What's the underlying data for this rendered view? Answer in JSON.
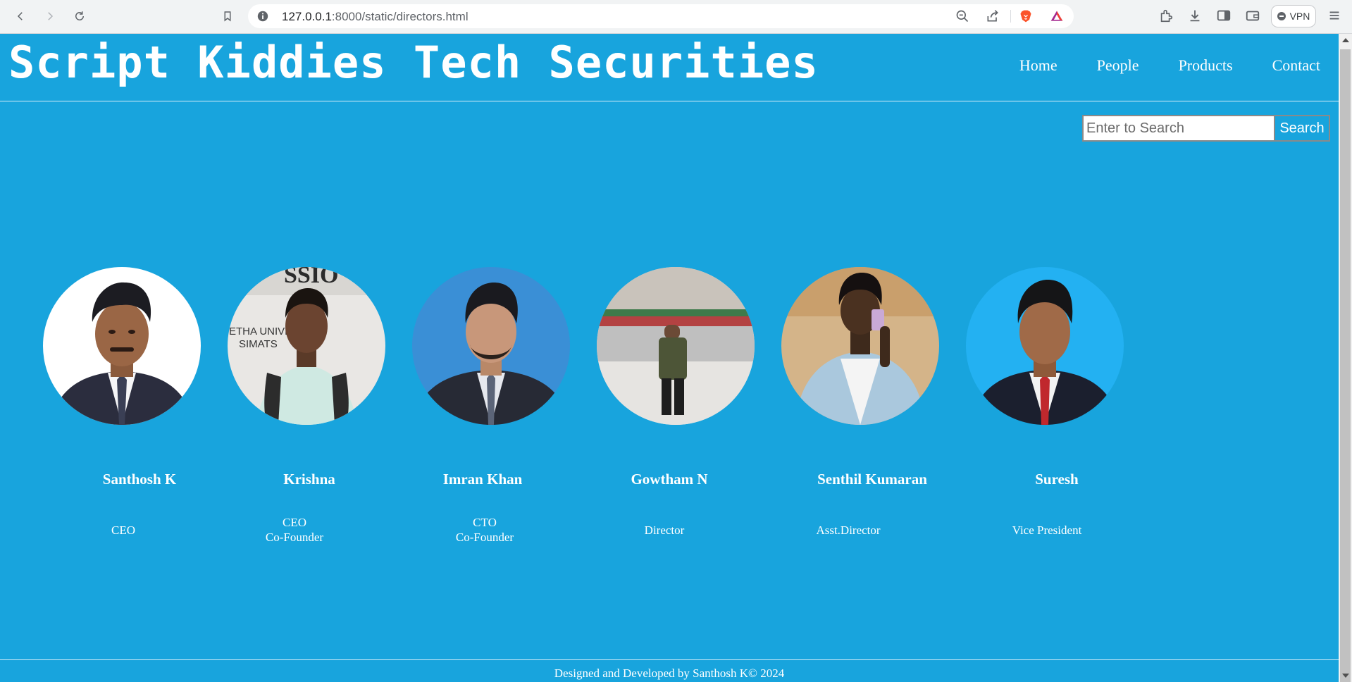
{
  "browser": {
    "url_host": "127.0.0.1",
    "url_path": ":8000/static/directors.html",
    "vpn_label": "VPN"
  },
  "site": {
    "title": "Script Kiddies Tech Securities",
    "nav": [
      "Home",
      "People",
      "Products",
      "Contact"
    ]
  },
  "search": {
    "placeholder": "Enter to Search",
    "button_label": "Search"
  },
  "people": [
    {
      "name": "Santhosh K",
      "role_line1": "CEO",
      "role_line2": ""
    },
    {
      "name": "Krishna",
      "role_line1": "CEO",
      "role_line2": "Co-Founder"
    },
    {
      "name": "Imran Khan",
      "role_line1": "CTO",
      "role_line2": "Co-Founder"
    },
    {
      "name": "Gowtham N",
      "role_line1": "Director",
      "role_line2": ""
    },
    {
      "name": "Senthil Kumaran",
      "role_line1": "Asst.Director",
      "role_line2": ""
    },
    {
      "name": "Suresh",
      "role_line1": "Vice President",
      "role_line2": ""
    }
  ],
  "photo_text": {
    "krishna_banner": "SSIO",
    "krishna_sign_line1": "ETHA UNIVE",
    "krishna_sign_line2": "SIMATS"
  },
  "footer": {
    "text": "Designed and Developed by Santhosh K© 2024"
  },
  "colors": {
    "page_background": "#18a4dd",
    "text": "#ffffff"
  },
  "icons": [
    "back-arrow-icon",
    "forward-arrow-icon",
    "reload-icon",
    "bookmark-icon",
    "site-info-icon",
    "zoom-out-icon",
    "share-icon",
    "brave-lion-icon",
    "brave-rewards-icon",
    "extensions-icon",
    "download-icon",
    "sidebar-icon",
    "wallet-icon",
    "menu-icon"
  ]
}
